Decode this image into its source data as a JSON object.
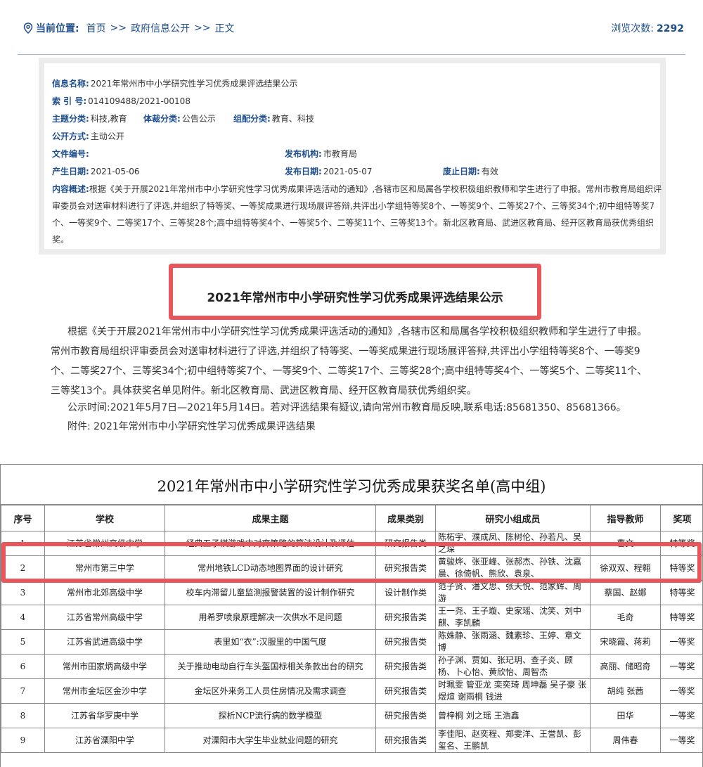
{
  "breadcrumb": {
    "label": "当前位置:",
    "items": [
      "首页",
      "政府信息公开",
      "正文"
    ],
    "separator": ">>"
  },
  "views": {
    "label": "浏览次数:",
    "count": "2292"
  },
  "info": {
    "name_k": "信息名称:",
    "name_v": "2021年常州市中小学研究性学习优秀成果评选结果公示",
    "index_k": "索 引 号:",
    "index_v": "014109488/2021-00108",
    "topic_k": "主题分类:",
    "topic_v": "科技,教育",
    "genre_k": "体裁分类:",
    "genre_v": "公告公示",
    "org_k": "组配分类:",
    "org_v": "教育、科技",
    "open_k": "公开方式:",
    "open_v": "主动公开",
    "docno_k": "文件编号:",
    "docno_v": "",
    "pub_org_k": "发布机构:",
    "pub_org_v": "市教育局",
    "created_k": "产生日期:",
    "created_v": "2021-05-06",
    "pubdate_k": "发布日期:",
    "pubdate_v": "2021-05-07",
    "expire_k": "废止日期:",
    "expire_v": "有效",
    "summary_k": "内容概述:",
    "summary_v": "根据《关于开展2021年常州市中小学研究性学习优秀成果评选活动的通知》,各辖市区和局属各学校积极组织教师和学生进行了申报。常州市教育局组织评审委员会对送审材料进行了评选,并组织了特等奖、一等奖成果进行现场展评答辩,共评出小学组特等奖8个、一等奖9个、二等奖27个、三等奖34个;初中组特等奖7个、一等奖9个、二等奖17个、三等奖28个;高中组特等奖4个、一等奖5个、二等奖11个、三等奖13个。新北区教育局、武进区教育局、经开区教育局获优秀组织奖。"
  },
  "article": {
    "title": "2021年常州市中小学研究性学习优秀成果评选结果公示",
    "body": "根据《关于开展2021年常州市中小学研究性学习优秀成果评选活动的通知》,各辖市区和局属各学校积极组织教师和学生进行了申报。常州市教育局组织评审委员会对送审材料进行了评选,并组织了特等奖、一等奖成果进行现场展评答辩,共评出小学组特等奖8个、一等奖9个、二等奖27个、三等奖34个;初中组特等奖7个、一等奖9个、二等奖17个、三等奖28个;高中组特等奖4个、一等奖5个、二等奖11个、三等奖13个。具体获奖名单见附件。新北区教育局、武进区教育局、经开区教育局获优秀组织奖。",
    "publicity": "公示时间:2021年5月7日—2021年5月14日。若对评选结果有疑议,请向常州市教育局反映,联系电话:85681350、85681366。",
    "attachment": "附件:  2021年常州市中小学研究性学习优秀成果评选结果"
  },
  "awards": {
    "title": "2021年常州市中小学研究性学习优秀成果获奖名单(高中组)",
    "headers": [
      "序号",
      "学校",
      "成果主题",
      "成果类别",
      "研究小组成员",
      "指导教师",
      "奖项"
    ],
    "rows": [
      [
        "1",
        "江苏省常州高级中学",
        "经典五子棋游戏中对弈策略的算法设计及评估",
        "研究报告类",
        "陈柘宇、濮成凤、陈树伦、孙若凡、吴之琛",
        "曹文",
        "特等奖"
      ],
      [
        "2",
        "常州市第三中学",
        "常州地铁LCD动态地图界面的设计研究",
        "研究报告类",
        "黄骏烨、张亚峰、张郝杰、孙铁、沈嘉晨、徐倚帆、熊欣、袁泉、",
        "徐双双、程翱",
        "特等奖"
      ],
      [
        "3",
        "常州市北郊高级中学",
        "校车内滞留儿童监测报警装置的设计制作研究",
        "设计制作类",
        "范子贤、潘文思、张天悦、范家辉、周游",
        "蔡国、赵娜",
        "特等奖"
      ],
      [
        "4",
        "江苏省常州高级中学",
        "用希罗喷泉原理解决一次供水不足问题",
        "研究报告类",
        "王一尧、王子璇、史家瑶、沈笑、刘中麒、李凯麟",
        "毛奇",
        "特等奖"
      ],
      [
        "5",
        "江苏省武进高级中学",
        "表里如“衣”:汉服里的中国气度",
        "研究报告类",
        "陈姝静、张雨涵、魏素珍、王婷、章文博",
        "宋晓霞、蒋莉",
        "一等奖"
      ],
      [
        "6",
        "常州市田家炳高级中学",
        "关于推动电动自行车头盔国标相关条款出台的研究",
        "研究报告类",
        "孙子渊、贾如、张玘玥、查子炎、顾杨、卜心怡、黄欣怡、周智杰",
        "高丽、储昭奇",
        "一等奖"
      ],
      [
        "7",
        "常州市金坛区金沙中学",
        "金坛区外来务工人员住房情况及需求调查",
        "研究报告类",
        "时珮雯  管亚龙  栾奕琦  周坤磊  吴子豪  张煜煊  谢雨桐  钱进",
        "胡纯  张茜",
        "一等奖"
      ],
      [
        "8",
        "江苏省华罗庚中学",
        "探析NCP流行病的数学模型",
        "研究报告类",
        "曾梓桐  刘之瑶  王浩鑫",
        "田华",
        "一等奖"
      ],
      [
        "9",
        "江苏省溧阳中学",
        "对溧阳市大学生毕业就业问题的研究",
        "研究报告类",
        "李佳阳、赵奕程、郑雯洋、王誉凯、彭玺名、王鹏凯",
        "周伟春",
        "一等奖"
      ]
    ]
  },
  "colors": {
    "accent": "#1f4e8c",
    "highlight": "#e8555a",
    "info_bg": "#ececec"
  }
}
